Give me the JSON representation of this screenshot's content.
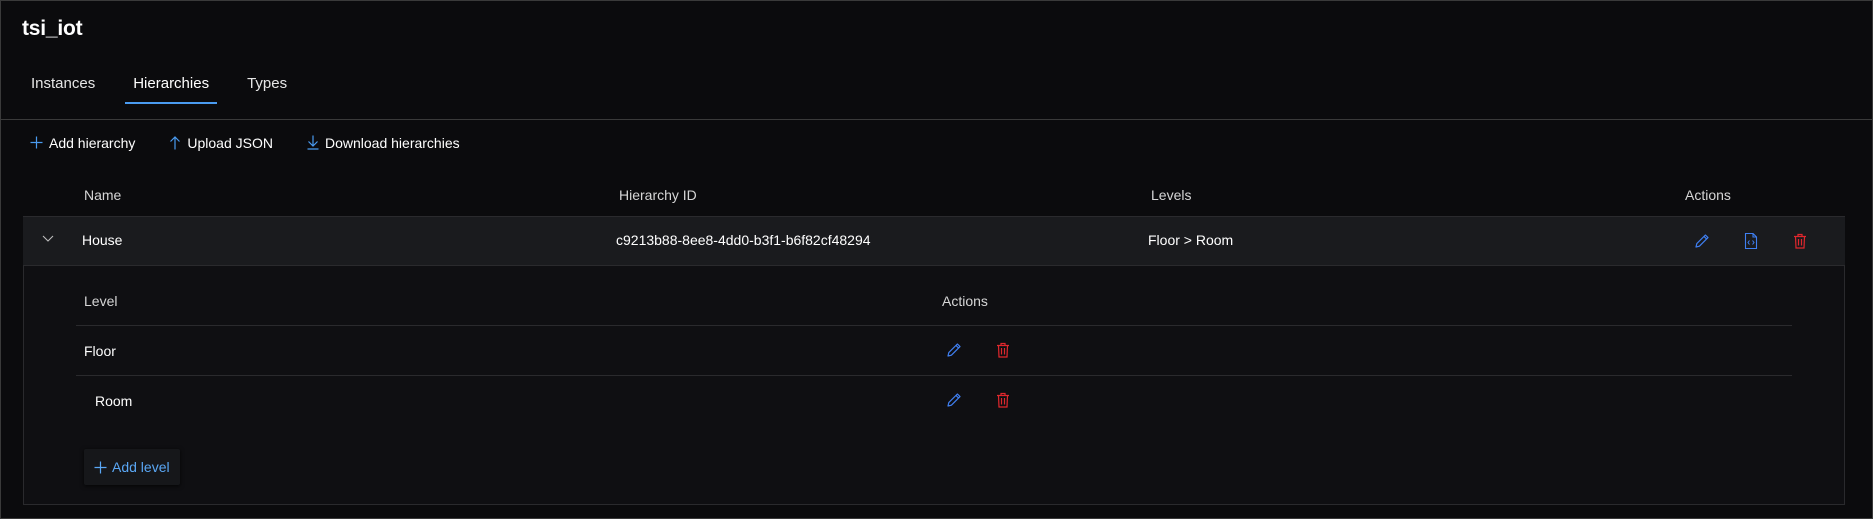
{
  "app": {
    "title": "tsi_iot"
  },
  "tabs": [
    {
      "label": "Instances",
      "active": false
    },
    {
      "label": "Hierarchies",
      "active": true
    },
    {
      "label": "Types",
      "active": false
    }
  ],
  "toolbar": {
    "add_hierarchy": "Add hierarchy",
    "upload_json": "Upload JSON",
    "download_hierarchies": "Download hierarchies"
  },
  "grid": {
    "columns": {
      "name": "Name",
      "id": "Hierarchy ID",
      "levels": "Levels",
      "actions": "Actions"
    },
    "rows": [
      {
        "name": "House",
        "id": "c9213b88-8ee8-4dd0-b3f1-b6f82cf48294",
        "levels": "Floor > Room",
        "expanded": true
      }
    ]
  },
  "details": {
    "columns": {
      "level": "Level",
      "actions": "Actions"
    },
    "levels": [
      {
        "name": "Floor"
      },
      {
        "name": "Room"
      }
    ],
    "add_level": "Add level"
  },
  "icons": {
    "accent": "#4a9bf0",
    "edit_color": "#3f7ff2",
    "delete_color": "#e0272d"
  }
}
